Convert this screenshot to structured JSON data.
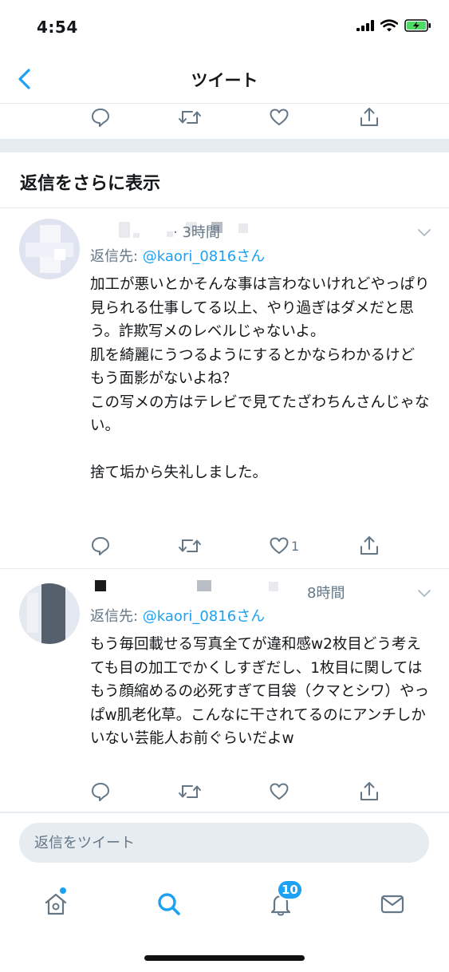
{
  "status_bar": {
    "time": "4:54"
  },
  "nav": {
    "title": "ツイート"
  },
  "more_replies": {
    "title": "返信をさらに表示"
  },
  "tweets": [
    {
      "time": "· 3時間",
      "reply_prefix": "返信先: ",
      "reply_handle": "@kaori_0816さん",
      "body": "加工が悪いとかそんな事は言わないけれどやっぱり見られる仕事してる以上、やり過ぎはダメだと思う。詐欺写メのレベルじゃないよ。\n肌を綺麗にうつるようにするとかならわかるけど\nもう面影がないよね？\nこの写メの方はテレビで見てたざわちんさんじゃない。\n\n捨て垢から失礼しました。",
      "like_count": "1"
    },
    {
      "time": "8時間",
      "reply_prefix": "返信先: ",
      "reply_handle": "@kaori_0816さん",
      "body": "もう毎回載せる写真全てが違和感w2枚目どう考えても目の加工でかくしすぎだし、1枚目に関してはもう顔縮めるの必死すぎて目袋（クマとシワ）やっぱw肌老化草。こんなに干されてるのにアンチしかいない芸能人お前ぐらいだよw",
      "like_count": ""
    }
  ],
  "compose": {
    "placeholder": "返信をツイート"
  },
  "tabs": {
    "notifications_badge": "10"
  },
  "colors": {
    "accent": "#1da1f2",
    "secondary_text": "#657786",
    "divider": "#e6ecf0"
  },
  "icons": [
    "back-chevron-icon",
    "reply-icon",
    "retweet-icon",
    "like-icon",
    "share-icon",
    "home-icon",
    "search-icon",
    "notifications-icon",
    "messages-icon"
  ]
}
